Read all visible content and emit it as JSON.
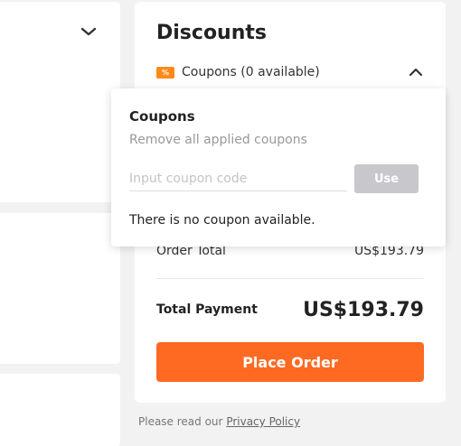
{
  "discounts": {
    "title": "Discounts",
    "coupon_tag": "%",
    "coupon_row_label": "Coupons (0 available)"
  },
  "popup": {
    "title": "Coupons",
    "remove_all": "Remove all applied coupons",
    "input_placeholder": "Input coupon code",
    "use_label": "Use",
    "empty_message": "There is no coupon available."
  },
  "summary": {
    "order_total_label": "Order Total",
    "order_total_value": "US$193.79",
    "total_payment_label": "Total Payment",
    "total_payment_value": "US$193.79"
  },
  "actions": {
    "place_order_label": "Place Order"
  },
  "footer": {
    "privacy_prefix": "Please read our",
    "privacy_link": "Privacy Policy"
  },
  "colors": {
    "accent": "#ff6a23",
    "coupon_tag": "#ff8a1a",
    "use_disabled": "#c8c8cc"
  }
}
